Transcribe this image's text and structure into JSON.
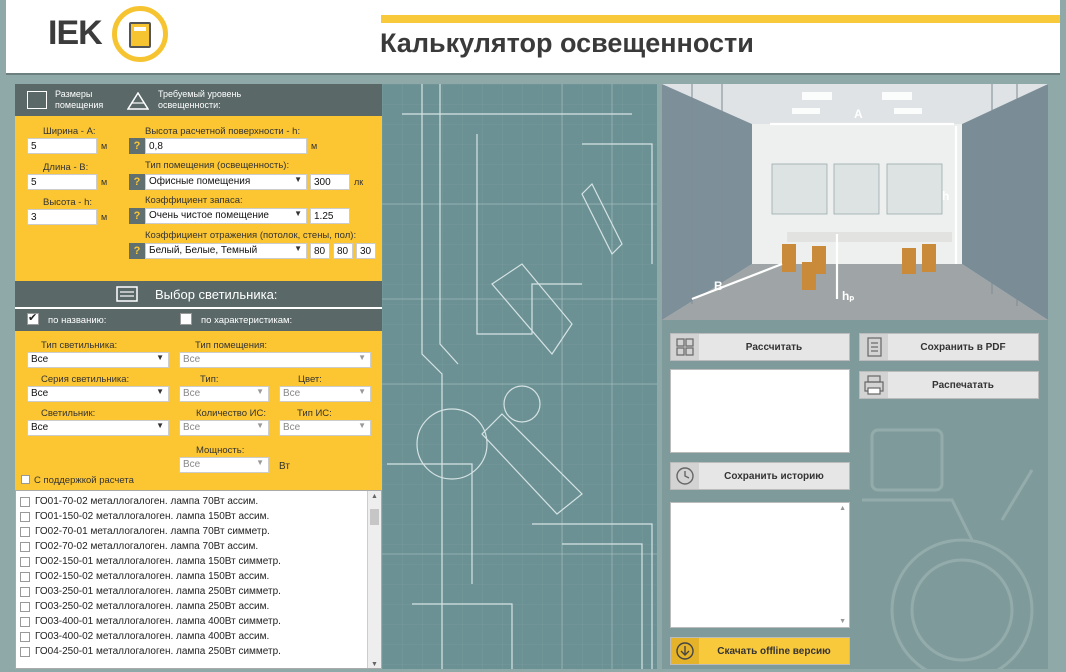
{
  "header": {
    "logo_text": "IEK",
    "title": "Калькулятор освещенности"
  },
  "room": {
    "tab_size": "Размеры помещения",
    "tab_level": "Требуемый уровень освещенности:",
    "width_label": "Ширина - А:",
    "width_value": "5",
    "length_label": "Длина - В:",
    "length_value": "5",
    "height_label": "Высота - h:",
    "height_value": "3",
    "unit_m": "м",
    "surface_label": "Высота расчетной поверхности - h:",
    "surface_value": "0,8",
    "room_type_label": "Тип помещения (освещенность):",
    "room_type_value": "Офисные помещения",
    "lux_value": "300",
    "lux_unit": "лк",
    "reserve_label": "Коэффициент запаса:",
    "reserve_value": "Очень чистое помещение",
    "reserve_num": "1.25",
    "reflect_label": "Коэффициент отражения (потолок, стены, пол):",
    "reflect_value": "Белый, Белые, Темный",
    "reflect_1": "80",
    "reflect_2": "80",
    "reflect_3": "30",
    "help": "?"
  },
  "luminaire": {
    "header": "Выбор светильника:",
    "by_name": "по названию:",
    "by_specs": "по характеристикам:",
    "type_label": "Тип светильника:",
    "type_value": "Все",
    "room_type_label": "Тип помещения:",
    "room_type_value": "Все",
    "series_label": "Серия светильника:",
    "series_value": "Все",
    "kind_label": "Тип:",
    "kind_value": "Все",
    "color_label": "Цвет:",
    "color_value": "Все",
    "lamp_label": "Светильник:",
    "lamp_value": "Все",
    "qty_label": "Количество ИС:",
    "qty_value": "Все",
    "src_type_label": "Тип ИС:",
    "src_type_value": "Все",
    "power_label": "Мощность:",
    "power_value": "Все",
    "power_unit": "Вт",
    "support_label": "С поддержкой расчета",
    "items": [
      "ГО01-70-02 металлогалоген. лампа 70Вт ассим.",
      "ГО01-150-02 металлогалоген. лампа 150Вт ассим.",
      "ГО02-70-01 металлогалоген. лампа 70Вт симметр.",
      "ГО02-70-02 металлогалоген. лампа 70Вт ассим.",
      "ГО02-150-01 металлогалоген. лампа 150Вт симметр.",
      "ГО02-150-02 металлогалоген. лампа 150Вт ассим.",
      "ГО03-250-01 металлогалоген. лампа 250Вт симметр.",
      "ГО03-250-02 металлогалоген. лампа 250Вт ассим.",
      "ГО03-400-01 металлогалоген. лампа 400Вт симметр.",
      "ГО03-400-02 металлогалоген. лампа 400Вт ассим.",
      "ГО04-250-01 металлогалоген. лампа 250Вт симметр."
    ]
  },
  "diagram": {
    "label_a": "A",
    "label_b": "B",
    "label_h": "h",
    "label_hp": "hₚ"
  },
  "actions": {
    "calculate": "Рассчитать",
    "save_pdf": "Сохранить в PDF",
    "print": "Распечатать",
    "save_history": "Сохранить историю",
    "download_offline": "Скачать offline версию"
  },
  "colors": {
    "accent": "#fcc632",
    "panel_dark": "#5a6868",
    "background": "#8fa8a8"
  }
}
